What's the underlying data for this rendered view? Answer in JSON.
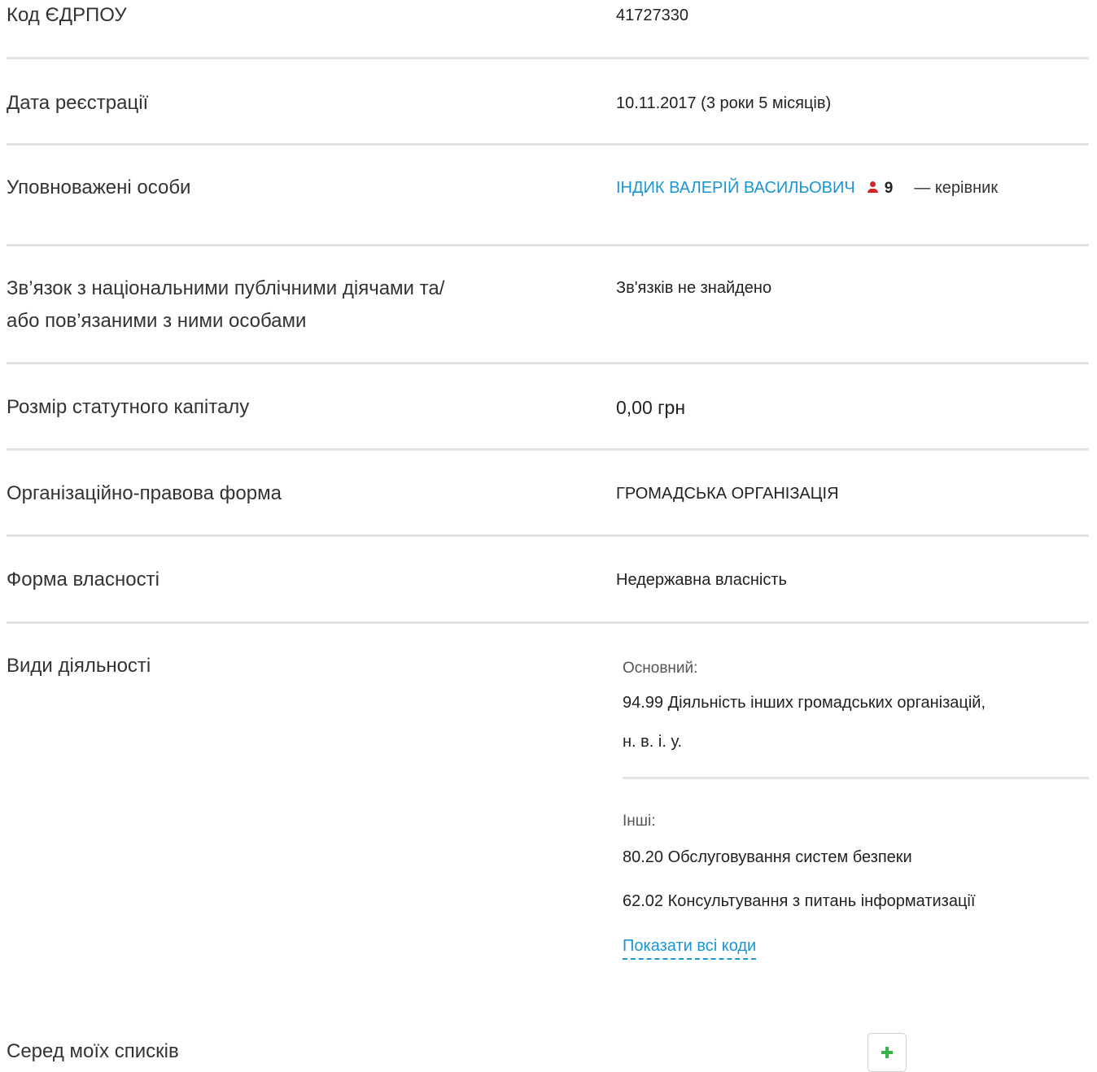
{
  "rows": [
    {
      "label": "Код ЄДРПОУ",
      "value": "41727330"
    },
    {
      "label": "Дата реєстрації",
      "value_date": "10.11.2017",
      "value_age": " (3 роки 5 місяців)"
    },
    {
      "label": "Уповноважені особи",
      "person_name": "ІНДИК ВАЛЕРІЙ ВАСИЛЬОВИЧ",
      "person_count": "9",
      "person_role": "— керівник"
    },
    {
      "label_line1": "Зв’язок з національними публічними діячами та/",
      "label_line2": "або пов’язаними з ними особами",
      "value": "Зв'язків не знайдено"
    },
    {
      "label": "Розмір статутного капіталу",
      "value": "0,00 грн"
    },
    {
      "label": "Організаційно-правова форма",
      "value": "ГРОМАДСЬКА ОРГАНІЗАЦІЯ"
    },
    {
      "label": "Форма власності",
      "value": "Недержавна власність"
    },
    {
      "label": "Види діяльності",
      "main_label": "Основний:",
      "main_line1": "94.99 Діяльність інших громадських організацій,",
      "main_line2": "н. в. і. у.",
      "other_label": "Інші:",
      "other_items": [
        "80.20 Обслуговування систем безпеки",
        "62.02 Консультування з питань інформатизації"
      ],
      "show_all": "Показати всі коди"
    }
  ],
  "lists": {
    "label": "Серед моїх списків",
    "add_icon": "plus-icon",
    "add_color": "#3bb54a"
  },
  "colors": {
    "link": "#1a96d4",
    "person_icon": "#d3232c",
    "divider": "#e4e4e4"
  }
}
